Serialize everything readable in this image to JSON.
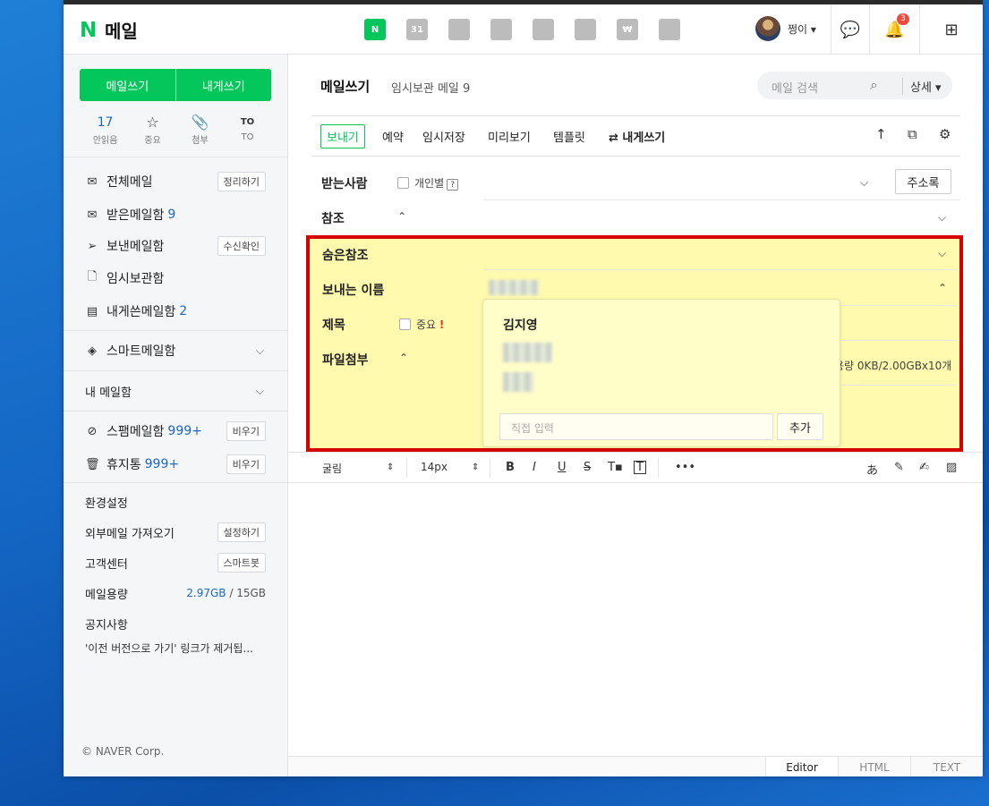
{
  "gnb": {
    "logo_n": "N",
    "logo_text": "메일",
    "services": [
      {
        "icon": "mail-icon",
        "glyph": "N"
      },
      {
        "icon": "calendar-icon",
        "glyph": "31"
      },
      {
        "icon": "photo-icon",
        "glyph": ""
      },
      {
        "icon": "contacts-icon",
        "glyph": ""
      },
      {
        "icon": "box-icon",
        "glyph": ""
      },
      {
        "icon": "todo-icon",
        "glyph": ""
      },
      {
        "icon": "pay-icon",
        "glyph": "₩"
      },
      {
        "icon": "keep-icon",
        "glyph": ""
      }
    ],
    "profile_name": "쩡이 ▾",
    "notification_count": "3"
  },
  "sidebar": {
    "write_mail": "메일쓰기",
    "write_self": "내게쓰기",
    "quick": [
      {
        "value": "17",
        "icon": "",
        "label": "안읽음"
      },
      {
        "value": "",
        "icon": "☆",
        "label": "중요"
      },
      {
        "value": "",
        "icon": "📎",
        "label": "첨부"
      },
      {
        "value": "",
        "icon": "TO",
        "label": "TO"
      }
    ],
    "all_mail": "전체메일",
    "all_mail_btn": "정리하기",
    "inbox": "받은메일함",
    "inbox_count": "9",
    "sent": "보낸메일함",
    "sent_btn": "수신확인",
    "drafts": "임시보관함",
    "self_sent": "내게쓴메일함",
    "self_sent_count": "2",
    "smart_box": "스마트메일함",
    "my_box": "내 메일함",
    "spam": "스팸메일함",
    "spam_count": "999+",
    "spam_btn": "비우기",
    "trash": "휴지통",
    "trash_count": "999+",
    "trash_btn": "비우기",
    "settings": "환경설정",
    "import": "외부메일 가져오기",
    "import_btn": "설정하기",
    "support": "고객센터",
    "support_btn": "스마트봇",
    "storage_label": "메일용량",
    "storage_used": "2.97GB",
    "storage_sep": " / ",
    "storage_total": "15GB",
    "notice_title": "공지사항",
    "notice_text": "'이전 버전으로 가기' 링크가 제거됩...",
    "copyright": "© NAVER Corp."
  },
  "compose": {
    "title": "메일쓰기",
    "subtitle": "임시보관 메일 9",
    "search_placeholder": "메일 검색",
    "search_detail": "상세 ▾",
    "toolbar": {
      "send": "보내기",
      "schedule": "예약",
      "save_draft": "임시저장",
      "preview": "미리보기",
      "template": "템플릿",
      "self_write": "⇄ 내게쓰기"
    },
    "to_label": "받는사람",
    "individual": "개인별",
    "addressbook": "주소록",
    "cc_label": "참조",
    "bcc_label": "숨은참조",
    "sender_label": "보내는 이름",
    "subject_label": "제목",
    "important": "중요",
    "important_mark": "!",
    "attach_label": "파일첨부",
    "attach_info": "용량 0KB/2.00GBx10개",
    "popup_name": "김지영",
    "popup_input_placeholder": "직접 입력",
    "popup_add": "추가"
  },
  "editor": {
    "font": "굴림",
    "size": "14px",
    "tabs": [
      "Editor",
      "HTML",
      "TEXT"
    ]
  },
  "colors": {
    "brand": "#03c75a",
    "highlight_fill": "#fffaad",
    "highlight_border": "#d60000",
    "link_blue": "#1a67c9"
  }
}
